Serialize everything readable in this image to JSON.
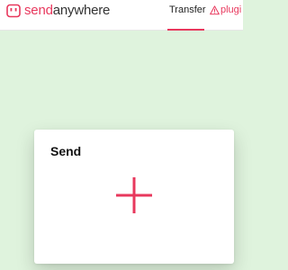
{
  "header": {
    "logo": {
      "part1": "send",
      "part2": "anywhere"
    },
    "tabs": [
      {
        "label": "Transfer",
        "active": true
      }
    ],
    "warning": {
      "label": "plugi",
      "icon": "warning-triangle-icon"
    }
  },
  "main": {
    "send_card": {
      "title": "Send",
      "add_icon": "plus-icon"
    }
  },
  "colors": {
    "accent": "#e8385d",
    "background": "#dff3dd",
    "card": "#ffffff"
  }
}
